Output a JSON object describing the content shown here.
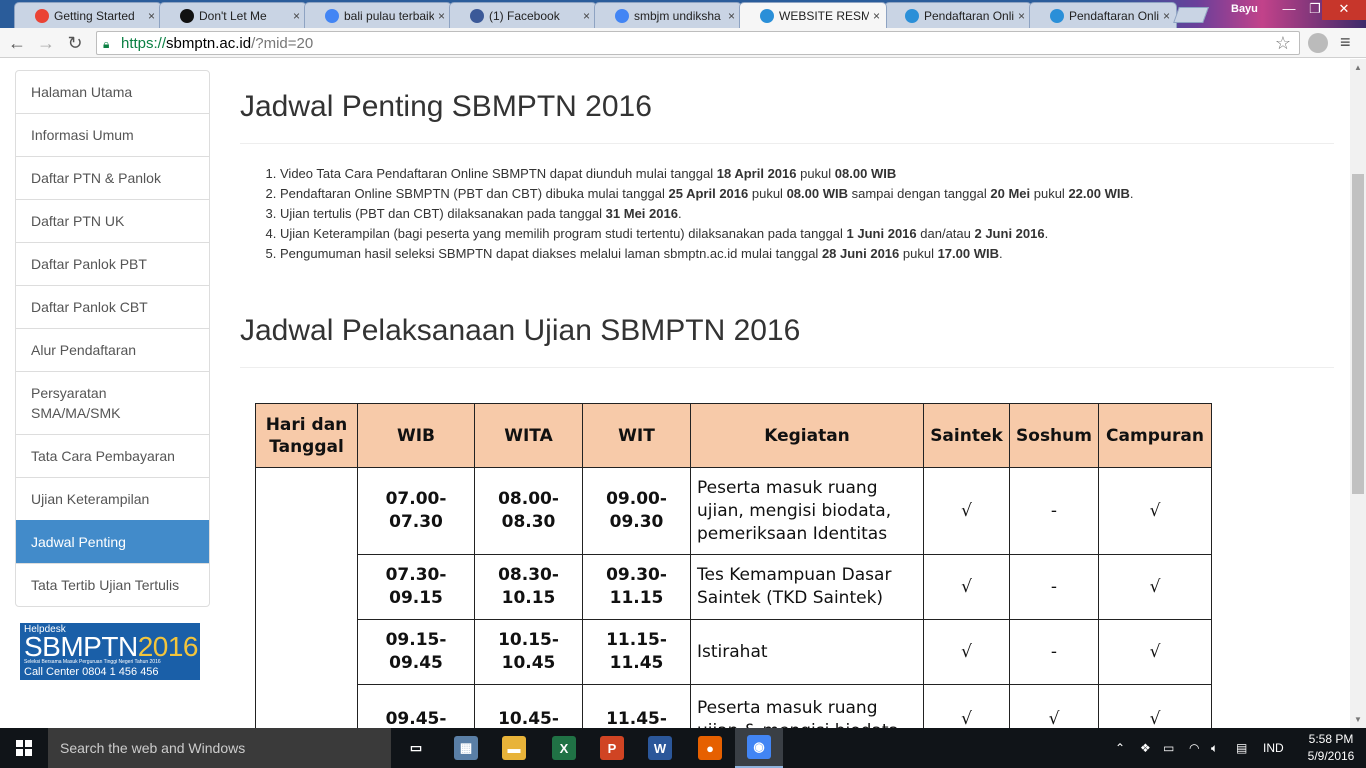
{
  "browser": {
    "tabs": [
      {
        "title": "Getting Started",
        "icon": "google-icon",
        "color": "#ea4335"
      },
      {
        "title": "Don't Let Me",
        "icon": "audio-icon",
        "color": "#111111"
      },
      {
        "title": "bali pulau terbaik",
        "icon": "google-icon",
        "color": "#4285f4"
      },
      {
        "title": "(1) Facebook",
        "icon": "facebook-icon",
        "color": "#3b5998"
      },
      {
        "title": "smbjm undiksha",
        "icon": "google-icon",
        "color": "#4285f4"
      },
      {
        "title": "WEBSITE RESMI S",
        "icon": "globe-icon",
        "color": "#2a8fd8"
      },
      {
        "title": "Pendaftaran Onli",
        "icon": "globe-icon",
        "color": "#2a8fd8"
      },
      {
        "title": "Pendaftaran Onli",
        "icon": "globe-icon",
        "color": "#2a8fd8"
      }
    ],
    "active_tab": 5,
    "user_name": "Bayu",
    "url_scheme": "https://",
    "url_host": "sbmptn.ac.id",
    "url_path": "/?mid=20"
  },
  "sidebar": {
    "items": [
      {
        "label": "Halaman Utama"
      },
      {
        "label": "Informasi Umum"
      },
      {
        "label": "Daftar PTN & Panlok"
      },
      {
        "label": "Daftar PTN UK"
      },
      {
        "label": "Daftar Panlok PBT"
      },
      {
        "label": "Daftar Panlok CBT"
      },
      {
        "label": "Alur Pendaftaran"
      },
      {
        "label": "Persyaratan SMA/MA/SMK"
      },
      {
        "label": "Tata Cara Pembayaran"
      },
      {
        "label": "Ujian Keterampilan"
      },
      {
        "label": "Jadwal Penting",
        "active": true
      },
      {
        "label": "Tata Tertib Ujian Tertulis"
      }
    ],
    "helpdesk": {
      "small": "Helpdesk",
      "big": "SBMPTN",
      "year": "2016",
      "tagline": "Seleksi Bersama Masuk Perguruan Tinggi Negeri Tahun 2016",
      "call": "Call Center 0804 1 456 456"
    }
  },
  "content": {
    "heading1": "Jadwal Penting SBMPTN 2016",
    "schedule": [
      [
        {
          "t": "Video Tata Cara Pendaftaran Online SBMPTN dapat diunduh mulai tanggal "
        },
        {
          "t": "18 April 2016",
          "b": true
        },
        {
          "t": " pukul "
        },
        {
          "t": "08.00 WIB",
          "b": true
        }
      ],
      [
        {
          "t": "Pendaftaran Online SBMPTN (PBT dan CBT) dibuka mulai tanggal "
        },
        {
          "t": "25 April 2016",
          "b": true
        },
        {
          "t": " pukul "
        },
        {
          "t": "08.00 WIB",
          "b": true
        },
        {
          "t": " sampai dengan tanggal "
        },
        {
          "t": "20 Mei",
          "b": true
        },
        {
          "t": " pukul "
        },
        {
          "t": "22.00 WIB",
          "b": true
        },
        {
          "t": "."
        }
      ],
      [
        {
          "t": "Ujian tertulis (PBT dan CBT) dilaksanakan pada tanggal "
        },
        {
          "t": "31 Mei 2016",
          "b": true
        },
        {
          "t": "."
        }
      ],
      [
        {
          "t": "Ujian Keterampilan (bagi peserta yang memilih program studi tertentu) dilaksanakan pada tanggal "
        },
        {
          "t": "1 Juni 2016",
          "b": true
        },
        {
          "t": " dan/atau "
        },
        {
          "t": "2 Juni 2016",
          "b": true
        },
        {
          "t": "."
        }
      ],
      [
        {
          "t": "Pengumuman hasil seleksi SBMPTN dapat diakses melalui laman sbmptn.ac.id mulai tanggal "
        },
        {
          "t": "28 Juni 2016",
          "b": true
        },
        {
          "t": " pukul "
        },
        {
          "t": "17.00 WIB",
          "b": true
        },
        {
          "t": "."
        }
      ]
    ],
    "heading2": "Jadwal Pelaksanaan Ujian SBMPTN 2016",
    "table": {
      "headers": [
        "Hari dan Tanggal",
        "WIB",
        "WITA",
        "WIT",
        "Kegiatan",
        "Saintek",
        "Soshum",
        "Campuran"
      ],
      "rows": [
        {
          "wib": "07.00-07.30",
          "wita": "08.00-08.30",
          "wit": "09.00-09.30",
          "kegiatan": "Peserta masuk ruang ujian, mengisi biodata, pemeriksaan Identitas",
          "saintek": "√",
          "soshum": "-",
          "campuran": "√"
        },
        {
          "wib": "07.30-09.15",
          "wita": "08.30-10.15",
          "wit": "09.30-11.15",
          "kegiatan": "Tes Kemampuan Dasar Saintek (TKD Saintek)",
          "saintek": "√",
          "soshum": "-",
          "campuran": "√"
        },
        {
          "wib": "09.15-09.45",
          "wita": "10.15-10.45",
          "wit": "11.15-11.45",
          "kegiatan": "Istirahat",
          "saintek": "√",
          "soshum": "-",
          "campuran": "√"
        },
        {
          "wib": "09.45-",
          "wita": "10.45-",
          "wit": "11.45-",
          "kegiatan": "Peserta masuk ruang ujian & mengisi biodata",
          "saintek": "√",
          "soshum": "√",
          "campuran": "√"
        }
      ]
    }
  },
  "taskbar": {
    "search_placeholder": "Search the web and Windows",
    "apps": [
      {
        "name": "task-view-icon",
        "glyph": "▭",
        "color": "#101418"
      },
      {
        "name": "photos-icon",
        "glyph": "▦",
        "color": "#5a7fa6"
      },
      {
        "name": "file-explorer-icon",
        "glyph": "▬",
        "color": "#e8b339"
      },
      {
        "name": "excel-icon",
        "glyph": "X",
        "color": "#207245"
      },
      {
        "name": "powerpoint-icon",
        "glyph": "P",
        "color": "#d04423"
      },
      {
        "name": "word-icon",
        "glyph": "W",
        "color": "#2b579a"
      },
      {
        "name": "firefox-icon",
        "glyph": "●",
        "color": "#e66000"
      },
      {
        "name": "chrome-icon",
        "glyph": "◉",
        "color": "#4285f4",
        "running": true
      }
    ],
    "language": "IND",
    "time": "5:58 PM",
    "date": "5/9/2016"
  }
}
